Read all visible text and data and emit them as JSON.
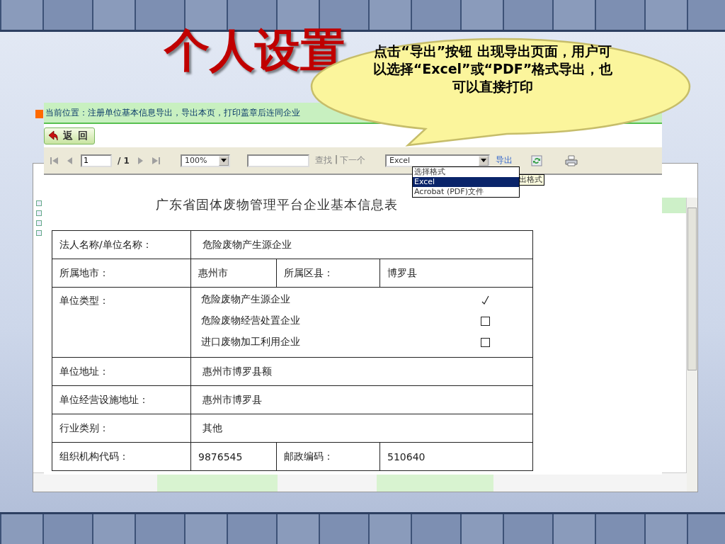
{
  "slide": {
    "title": "个人设置"
  },
  "callout": {
    "text": "点击“导出”按钮 出现导出页面，用户可以选择“Excel”或“PDF”格式导出，也可以直接打印"
  },
  "window": {
    "breadcrumb": "当前位置：注册单位基本信息导出，导出本页，打印盖章后连同企业",
    "back_button": "返 回",
    "toolbar": {
      "page": "1",
      "page_total": "/ 1",
      "zoom": "100%",
      "find": "查找",
      "separator": "|",
      "next": "下一个",
      "next_disabled": true,
      "format": "Excel",
      "export": "导出"
    },
    "format_options": [
      {
        "label": "选择格式",
        "selected": false
      },
      {
        "label": "Excel",
        "selected": true
      },
      {
        "label": "Acrobat (PDF)文件",
        "selected": false
      }
    ],
    "tooltip": "出格式",
    "report": {
      "title": "广东省固体废物管理平台企业基本信息表",
      "rows": [
        {
          "kind": "single",
          "label": "法人名称/单位名称：",
          "value": "危险废物产生源企业"
        },
        {
          "kind": "pair",
          "label": "所属地市：",
          "value": "惠州市",
          "label_2": "所属区县：",
          "value_2": "博罗县"
        },
        {
          "kind": "types",
          "label": "单位类型：",
          "options": [
            {
              "label": "危险废物产生源企业",
              "checked": true
            },
            {
              "label": "危险废物经营处置企业",
              "checked": false
            },
            {
              "label": "进口废物加工利用企业",
              "checked": false
            }
          ]
        },
        {
          "kind": "single",
          "label": "单位地址：",
          "value": "惠州市博罗县额"
        },
        {
          "kind": "single",
          "label": "单位经营设施地址：",
          "value": "惠州市博罗县"
        },
        {
          "kind": "single",
          "label": "行业类别：",
          "value": "其他"
        },
        {
          "kind": "pair",
          "label": "组织机构代码：",
          "value": "9876545",
          "label_2": "邮政编码：",
          "value_2": "510640"
        }
      ]
    }
  }
}
